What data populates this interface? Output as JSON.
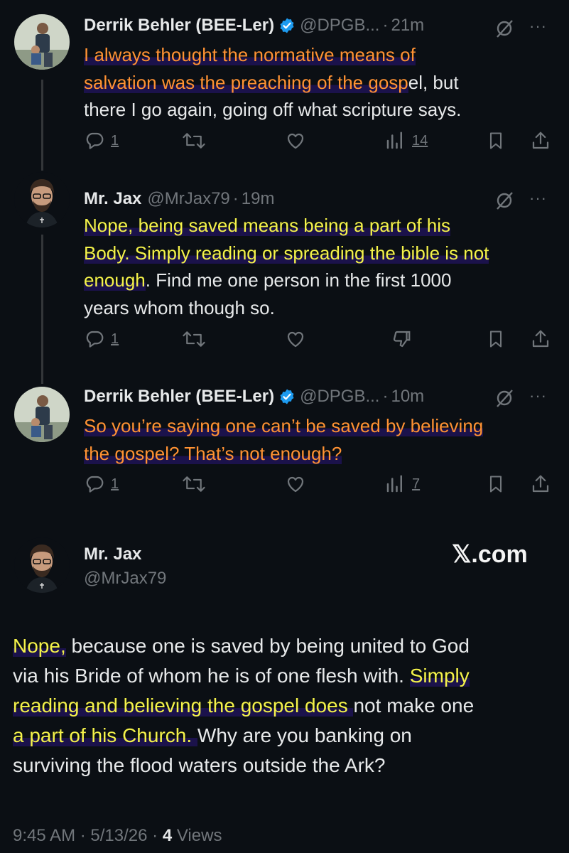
{
  "posts": [
    {
      "name": "Derrik Behler (BEE-Ler)",
      "handle": "@DPGB...",
      "sep": "·",
      "time": "21m",
      "text_parts": [
        {
          "t": "I always thought the normative means of",
          "c": "o"
        },
        {
          "t": "salvation was the preaching of the gosp",
          "c": "o"
        },
        {
          "t": "el, but",
          "c": "n"
        },
        {
          "t": "there I go again, going off what scripture says.",
          "c": "n"
        }
      ],
      "actions": {
        "replies": "1",
        "views": "14"
      }
    },
    {
      "name": "Mr. Jax",
      "handle": "@MrJax79",
      "sep": "·",
      "time": "19m",
      "text_parts": [
        {
          "t": "Nope, being saved means being a part of his",
          "c": "y"
        },
        {
          "t": "Body. Simply reading or spreading the bible is not",
          "c": "y"
        },
        {
          "t": "enough",
          "c": "y"
        },
        {
          "t": ". Find me one person in the first 1000",
          "c": "n"
        },
        {
          "t": "years whom though so.",
          "c": "n"
        }
      ],
      "actions": {
        "replies": "1"
      }
    },
    {
      "name": "Derrik Behler (BEE-Ler)",
      "handle": "@DPGB...",
      "sep": "·",
      "time": "10m",
      "text_parts": [
        {
          "t": "So you’re saying one can’t be saved by believing",
          "c": "o"
        },
        {
          "t": "the gospel? That’s not enough?",
          "c": "o"
        }
      ],
      "actions": {
        "replies": "1",
        "views": "7"
      }
    }
  ],
  "main_post": {
    "name": "Mr. Jax",
    "handle": "@MrJax79",
    "brand": "𝕏.com",
    "lines": [
      [
        {
          "t": "Nope,",
          "c": "y"
        },
        {
          "t": " because one is saved by being united to God",
          "c": "n"
        }
      ],
      [
        {
          "t": "via his Bride of whom he is of one flesh with. ",
          "c": "n"
        },
        {
          "t": "Simply",
          "c": "y"
        }
      ],
      [
        {
          "t": "reading and believing the gospel does ",
          "c": "y"
        },
        {
          "t": "not make one",
          "c": "n"
        }
      ],
      [
        {
          "t": "a part of his Church. ",
          "c": "y"
        },
        {
          "t": "Why are you banking on",
          "c": "n"
        }
      ],
      [
        {
          "t": "surviving the flood waters outside the Ark?",
          "c": "n"
        }
      ]
    ],
    "footer": {
      "time": "9:45 AM",
      "sep1": "·",
      "date": "5/13/26",
      "sep2": "·",
      "views_count": "4",
      "views_label": "Views"
    }
  },
  "colors": {
    "background": "#0b0f14",
    "orange_highlight": "#ff9233",
    "yellow_highlight": "#f4f24a",
    "verified": "#1d9bf0",
    "muted": "#71767b"
  },
  "icons": [
    "reply-icon",
    "retweet-icon",
    "like-icon",
    "views-icon",
    "bookmark-icon",
    "share-icon",
    "grok-icon",
    "more-icon",
    "verified-icon",
    "dislike-icon"
  ]
}
